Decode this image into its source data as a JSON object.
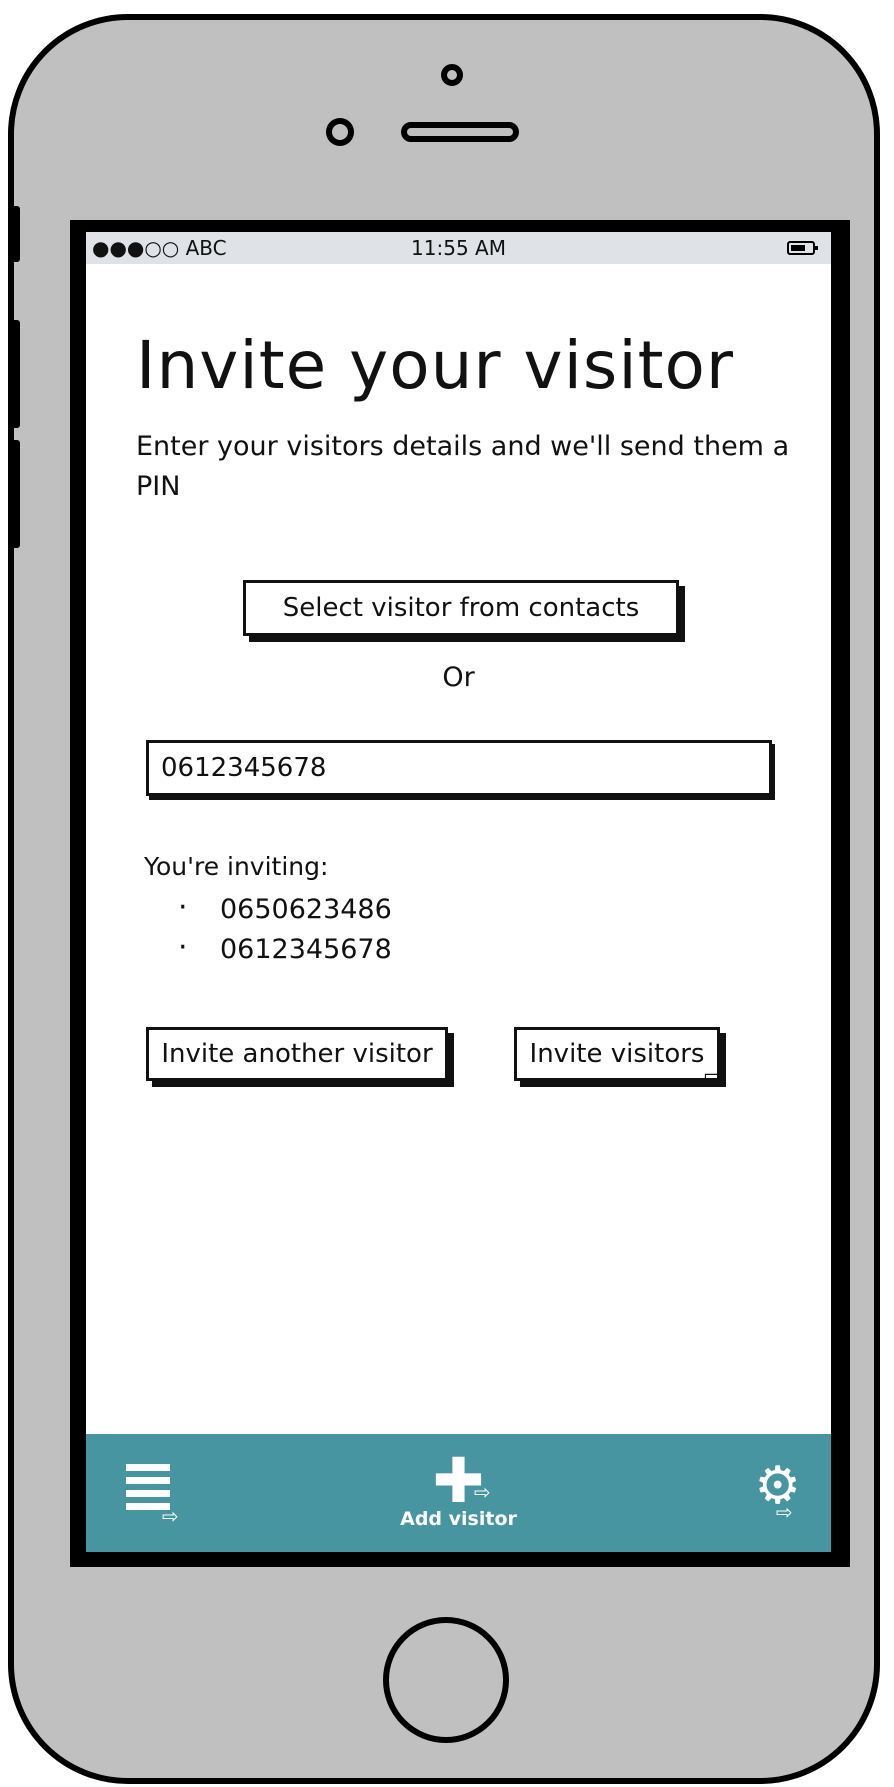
{
  "status_bar": {
    "carrier": "●●●○○ ABC",
    "time": "11:55 AM",
    "battery_icon": "battery-icon"
  },
  "page": {
    "title": "Invite your visitor",
    "description": "Enter your visitors details and we'll send them a PIN"
  },
  "actions": {
    "select_contacts_label": "Select visitor from contacts",
    "or_label": "Or",
    "invite_another_label": "Invite another visitor",
    "invite_visitors_label": "Invite visitors"
  },
  "phone_field": {
    "value": "0612345678"
  },
  "inviting": {
    "label": "You're inviting:",
    "numbers": [
      "0650623486",
      "0612345678"
    ]
  },
  "tab_bar": {
    "color": "#4895a2",
    "list_icon": "list-icon",
    "add_icon": "plus-icon",
    "add_label": "Add visitor",
    "settings_icon": "gear-icon"
  }
}
